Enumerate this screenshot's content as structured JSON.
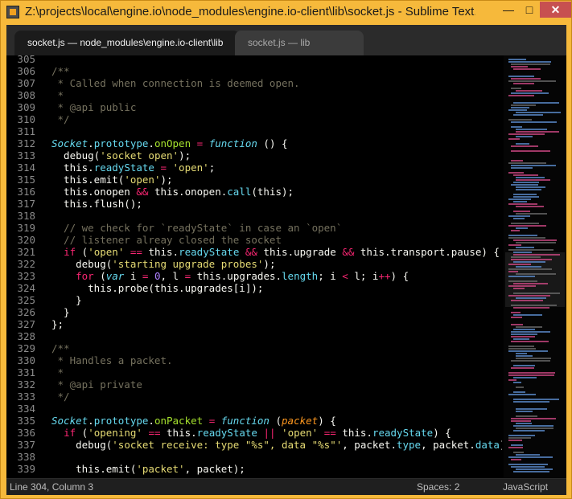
{
  "window": {
    "title": "Z:\\projects\\local\\engine.io\\node_modules\\engine.io-client\\lib\\socket.js - Sublime Text...",
    "minimize": "—",
    "maximize": "□",
    "close": "✕"
  },
  "tabs": [
    {
      "label": "socket.js — node_modules\\engine.io-client\\lib",
      "active": true
    },
    {
      "label": "socket.js — lib",
      "active": false
    }
  ],
  "colors": {
    "default": "#f8f8f2",
    "comment": "#75715e",
    "keyword": "#f92672",
    "string": "#e6db74",
    "function": "#a6e22e",
    "storage": "#66d9ef",
    "param": "#fd971f",
    "number": "#ae81ff"
  },
  "editor": {
    "lines": [
      {
        "num": "305",
        "tokens": []
      },
      {
        "num": "306",
        "tokens": [
          {
            "t": "/**",
            "c": "comment"
          }
        ]
      },
      {
        "num": "307",
        "tokens": [
          {
            "t": " * Called when connection is deemed open.",
            "c": "comment"
          }
        ]
      },
      {
        "num": "308",
        "tokens": [
          {
            "t": " *",
            "c": "comment"
          }
        ]
      },
      {
        "num": "309",
        "tokens": [
          {
            "t": " * @api public",
            "c": "comment"
          }
        ]
      },
      {
        "num": "310",
        "tokens": [
          {
            "t": " */",
            "c": "comment"
          }
        ]
      },
      {
        "num": "311",
        "tokens": []
      },
      {
        "num": "312",
        "tokens": [
          {
            "t": "Socket",
            "c": "storage",
            "i": true
          },
          {
            "t": ".",
            "c": "default"
          },
          {
            "t": "prototype",
            "c": "storage"
          },
          {
            "t": ".",
            "c": "default"
          },
          {
            "t": "onOpen",
            "c": "function"
          },
          {
            "t": " = ",
            "c": "keyword"
          },
          {
            "t": "function",
            "c": "storage",
            "i": true
          },
          {
            "t": " () {",
            "c": "default"
          }
        ]
      },
      {
        "num": "313",
        "tokens": [
          {
            "t": "  debug(",
            "c": "default"
          },
          {
            "t": "'socket open'",
            "c": "string"
          },
          {
            "t": ");",
            "c": "default"
          }
        ]
      },
      {
        "num": "314",
        "tokens": [
          {
            "t": "  this.",
            "c": "default"
          },
          {
            "t": "readyState",
            "c": "storage"
          },
          {
            "t": " = ",
            "c": "keyword"
          },
          {
            "t": "'open'",
            "c": "string"
          },
          {
            "t": ";",
            "c": "default"
          }
        ]
      },
      {
        "num": "315",
        "tokens": [
          {
            "t": "  this.emit(",
            "c": "default"
          },
          {
            "t": "'open'",
            "c": "string"
          },
          {
            "t": ");",
            "c": "default"
          }
        ]
      },
      {
        "num": "316",
        "tokens": [
          {
            "t": "  this.onopen ",
            "c": "default"
          },
          {
            "t": "&&",
            "c": "keyword"
          },
          {
            "t": " this.onopen.",
            "c": "default"
          },
          {
            "t": "call",
            "c": "storage"
          },
          {
            "t": "(this);",
            "c": "default"
          }
        ]
      },
      {
        "num": "317",
        "tokens": [
          {
            "t": "  this.flush();",
            "c": "default"
          }
        ]
      },
      {
        "num": "318",
        "tokens": []
      },
      {
        "num": "319",
        "tokens": [
          {
            "t": "  // we check for `readyState` in case an `open`",
            "c": "comment"
          }
        ]
      },
      {
        "num": "320",
        "tokens": [
          {
            "t": "  // listener alreay closed the socket",
            "c": "comment"
          }
        ]
      },
      {
        "num": "321",
        "tokens": [
          {
            "t": "  ",
            "c": "default"
          },
          {
            "t": "if",
            "c": "keyword"
          },
          {
            "t": " (",
            "c": "default"
          },
          {
            "t": "'open'",
            "c": "string"
          },
          {
            "t": " == ",
            "c": "keyword"
          },
          {
            "t": "this.",
            "c": "default"
          },
          {
            "t": "readyState",
            "c": "storage"
          },
          {
            "t": " && ",
            "c": "keyword"
          },
          {
            "t": "this.upgrade ",
            "c": "default"
          },
          {
            "t": "&&",
            "c": "keyword"
          },
          {
            "t": " this.transport.pause) {",
            "c": "default"
          }
        ]
      },
      {
        "num": "322",
        "tokens": [
          {
            "t": "    debug(",
            "c": "default"
          },
          {
            "t": "'starting upgrade probes'",
            "c": "string"
          },
          {
            "t": ");",
            "c": "default"
          }
        ]
      },
      {
        "num": "323",
        "tokens": [
          {
            "t": "    ",
            "c": "default"
          },
          {
            "t": "for",
            "c": "keyword"
          },
          {
            "t": " (",
            "c": "default"
          },
          {
            "t": "var",
            "c": "storage",
            "i": true
          },
          {
            "t": " i ",
            "c": "default"
          },
          {
            "t": "=",
            "c": "keyword"
          },
          {
            "t": " ",
            "c": "default"
          },
          {
            "t": "0",
            "c": "number"
          },
          {
            "t": ", l ",
            "c": "default"
          },
          {
            "t": "=",
            "c": "keyword"
          },
          {
            "t": " this.upgrades.",
            "c": "default"
          },
          {
            "t": "length",
            "c": "storage"
          },
          {
            "t": "; i ",
            "c": "default"
          },
          {
            "t": "<",
            "c": "keyword"
          },
          {
            "t": " l; i",
            "c": "default"
          },
          {
            "t": "++",
            "c": "keyword"
          },
          {
            "t": ") {",
            "c": "default"
          }
        ]
      },
      {
        "num": "324",
        "tokens": [
          {
            "t": "      this.probe(this.upgrades[i]);",
            "c": "default"
          }
        ]
      },
      {
        "num": "325",
        "tokens": [
          {
            "t": "    }",
            "c": "default"
          }
        ]
      },
      {
        "num": "326",
        "tokens": [
          {
            "t": "  }",
            "c": "default"
          }
        ]
      },
      {
        "num": "327",
        "tokens": [
          {
            "t": "};",
            "c": "default"
          }
        ]
      },
      {
        "num": "328",
        "tokens": []
      },
      {
        "num": "329",
        "tokens": [
          {
            "t": "/**",
            "c": "comment"
          }
        ]
      },
      {
        "num": "330",
        "tokens": [
          {
            "t": " * Handles a packet.",
            "c": "comment"
          }
        ]
      },
      {
        "num": "331",
        "tokens": [
          {
            "t": " *",
            "c": "comment"
          }
        ]
      },
      {
        "num": "332",
        "tokens": [
          {
            "t": " * @api private",
            "c": "comment"
          }
        ]
      },
      {
        "num": "333",
        "tokens": [
          {
            "t": " */",
            "c": "comment"
          }
        ]
      },
      {
        "num": "334",
        "tokens": []
      },
      {
        "num": "335",
        "tokens": [
          {
            "t": "Socket",
            "c": "storage",
            "i": true
          },
          {
            "t": ".",
            "c": "default"
          },
          {
            "t": "prototype",
            "c": "storage"
          },
          {
            "t": ".",
            "c": "default"
          },
          {
            "t": "onPacket",
            "c": "function"
          },
          {
            "t": " = ",
            "c": "keyword"
          },
          {
            "t": "function",
            "c": "storage",
            "i": true
          },
          {
            "t": " (",
            "c": "default"
          },
          {
            "t": "packet",
            "c": "param",
            "i": true
          },
          {
            "t": ") {",
            "c": "default"
          }
        ]
      },
      {
        "num": "336",
        "tokens": [
          {
            "t": "  ",
            "c": "default"
          },
          {
            "t": "if",
            "c": "keyword"
          },
          {
            "t": " (",
            "c": "default"
          },
          {
            "t": "'opening'",
            "c": "string"
          },
          {
            "t": " == ",
            "c": "keyword"
          },
          {
            "t": "this.",
            "c": "default"
          },
          {
            "t": "readyState",
            "c": "storage"
          },
          {
            "t": " || ",
            "c": "keyword"
          },
          {
            "t": "'open'",
            "c": "string"
          },
          {
            "t": " == ",
            "c": "keyword"
          },
          {
            "t": "this.",
            "c": "default"
          },
          {
            "t": "readyState",
            "c": "storage"
          },
          {
            "t": ") {",
            "c": "default"
          }
        ]
      },
      {
        "num": "337",
        "tokens": [
          {
            "t": "    debug(",
            "c": "default"
          },
          {
            "t": "'socket receive: type \"%s\", data \"%s\"'",
            "c": "string"
          },
          {
            "t": ", packet.",
            "c": "default"
          },
          {
            "t": "type",
            "c": "storage"
          },
          {
            "t": ", packet.",
            "c": "default"
          },
          {
            "t": "data",
            "c": "storage"
          },
          {
            "t": ");",
            "c": "default"
          }
        ]
      },
      {
        "num": "338",
        "tokens": []
      },
      {
        "num": "339",
        "tokens": [
          {
            "t": "    this.emit(",
            "c": "default"
          },
          {
            "t": "'packet'",
            "c": "string"
          },
          {
            "t": ", packet);",
            "c": "default"
          }
        ]
      }
    ]
  },
  "status": {
    "position": "Line 304, Column 3",
    "spaces": "Spaces: 2",
    "language": "JavaScript"
  }
}
